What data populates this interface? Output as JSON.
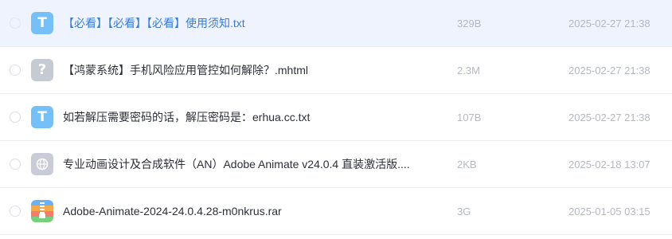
{
  "files": [
    {
      "name": "【必看】【必看】【必看】使用须知.txt",
      "size": "329B",
      "date": "2025-02-27 21:38",
      "icon": "txt-file-icon",
      "icon_glyph": "T",
      "selected": true
    },
    {
      "name": "【鸿蒙系统】手机风险应用管控如何解除？.mhtml",
      "size": "2.3M",
      "date": "2025-02-27 21:38",
      "icon": "unknown-file-icon",
      "icon_glyph": "?"
    },
    {
      "name": "如若解压需要密码的话，解压密码是：erhua.cc.txt",
      "size": "107B",
      "date": "2025-02-27 21:38",
      "icon": "txt-file-icon",
      "icon_glyph": "T"
    },
    {
      "name": "专业动画设计及合成软件（AN）Adobe Animate v24.0.4 直装激活版....",
      "size": "2KB",
      "date": "2025-02-18 13:07",
      "icon": "web-file-icon",
      "icon_glyph": ""
    },
    {
      "name": "Adobe-Animate-2024-24.0.4.28-m0nkrus.rar",
      "size": "3G",
      "date": "2025-01-05 03:15",
      "icon": "rar-archive-icon",
      "icon_glyph": ""
    }
  ],
  "colors": {
    "selected_row_bg": "#eef3fe",
    "selected_text": "#3a7bd5",
    "txt_icon": "#74c0f7",
    "muted_text": "#b4b8c0"
  }
}
